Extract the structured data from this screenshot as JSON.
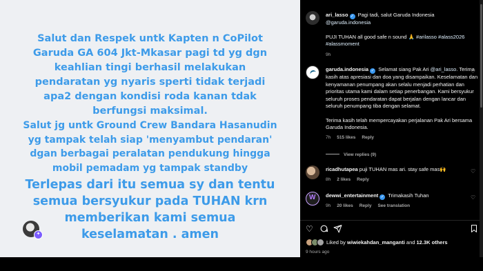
{
  "image": {
    "para1": "Salut dan Respek untk Kapten n CoPilot\nGaruda GA 604 Jkt-Mkasar pagi td yg dgn\nkeahlian tingi berhasil melakukan\npendaratan  yg nyaris sperti tidak terjadi\napa2 dengan kondisi roda kanan tdak\nberfungsi maksimal.",
    "para2": "Salut jg untk Ground Crew Bandara Hasanudin\nyg tampak telah siap 'menyambut pendaran'\ndgan berbagai peralatan pendukung hingga\nmobil pemadam yg tampak standby",
    "para3": "Terlepas dari itu semua sy dan tentu\nsemua bersyukur pada TUHAN krn\nmemberikan kami semua\nkeselamatan . amen"
  },
  "caption": {
    "username": "ari_lasso",
    "text1": "Pagi tadi, salut Garuda Indonesia",
    "mention": "@garuda.indonesia",
    "text2": "PUJI TUHAN all good safe n sound 🙏",
    "hashtags1": "#arilasso #alass2026",
    "hashtags2": "#alassmoment",
    "time": "9h"
  },
  "comments": [
    {
      "username": "garuda.indonesia",
      "text_before": "Selamat siang Pak Ari",
      "mention": "@ari_lasso",
      "text_after": ". Terima kasih atas apresiasi dan doa yang disampaikan. Keselamatan dan kenyamanan penumpang akan selalu menjadi perhatian dan prioritas utama kami dalam setiap penerbangan. Kami bersyukur seluruh proses pendaratan dapat berjalan dengan lancar dan seluruh penumpang tiba dengan selamat.",
      "text2": "Terima kasih telah mempercayakan perjalanan Pak Ari bersama Garuda Indonesia.",
      "time": "7h",
      "likes": "515 likes",
      "reply": "Reply",
      "view_replies": "View replies (9)"
    },
    {
      "username": "ricadhutapea",
      "text": "puji TUHAN mas ari. stay safe mas🙌",
      "time": "8h",
      "likes": "2 likes",
      "reply": "Reply"
    },
    {
      "username": "dewwi_entertainment",
      "text": "Trimakasih Tuhan",
      "time": "9h",
      "likes": "20 likes",
      "reply": "Reply",
      "see_translation": "See translation"
    }
  ],
  "likes_line": {
    "prefix": "Liked by",
    "user": "wiwiekahdan_manganti",
    "middle": "and",
    "others": "12.3K others"
  },
  "post_time": "9 hours ago",
  "icons": {
    "like": "heart-icon",
    "comment": "comment-icon",
    "share": "send-icon",
    "save": "bookmark-icon"
  }
}
